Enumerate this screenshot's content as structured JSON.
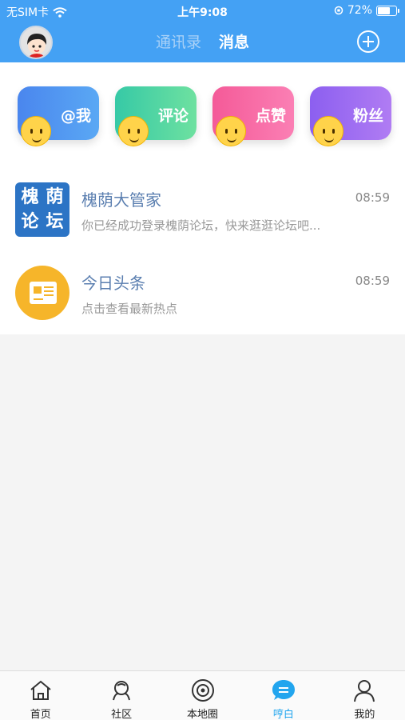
{
  "status": {
    "carrier": "无SIM卡",
    "time": "上午9:08",
    "battery": "72%",
    "battery_level": 0.72
  },
  "header": {
    "tab_contacts": "通讯录",
    "tab_messages": "消息"
  },
  "categories": [
    {
      "label": "@我",
      "color": "#4f8cf0"
    },
    {
      "label": "评论",
      "color": "#3fd0a0"
    },
    {
      "label": "点赞",
      "color": "#f564a5"
    },
    {
      "label": "粉丝",
      "color": "#9c6ff0"
    }
  ],
  "messages": [
    {
      "title": "槐荫大管家",
      "time": "08:59",
      "preview": "你已经成功登录槐荫论坛，快来逛逛论坛吧...",
      "logo_chars": [
        "槐",
        "荫",
        "论",
        "坛"
      ]
    },
    {
      "title": "今日头条",
      "time": "08:59",
      "preview": "点击查看最新热点"
    }
  ],
  "tabbar": {
    "items": [
      {
        "label": "首页",
        "icon": "home-icon"
      },
      {
        "label": "社区",
        "icon": "community-icon"
      },
      {
        "label": "本地圈",
        "icon": "local-circle-icon"
      },
      {
        "label": "哼白",
        "icon": "chat-bubble-icon",
        "active": true
      },
      {
        "label": "我的",
        "icon": "profile-icon"
      }
    ]
  }
}
